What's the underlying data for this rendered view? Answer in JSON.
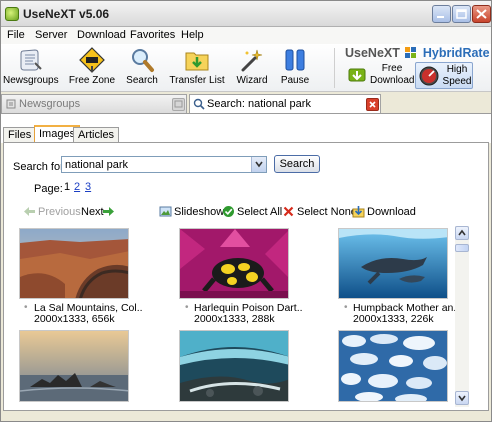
{
  "window": {
    "title": "UseNeXT v5.06"
  },
  "menu": [
    "File",
    "Server",
    "Download",
    "Favorites",
    "Help"
  ],
  "toolbar": {
    "buttons": [
      {
        "label": "Newsgroups",
        "icon": "newsgroups-scroll-icon"
      },
      {
        "label": "Free Zone",
        "icon": "free-zone-sign-icon"
      },
      {
        "label": "Search",
        "icon": "magnifier-icon"
      },
      {
        "label": "Transfer List",
        "icon": "transfer-list-folder-icon"
      },
      {
        "label": "Wizard",
        "icon": "wizard-wand-icon"
      },
      {
        "label": "Pause",
        "icon": "pause-icon"
      }
    ],
    "brand": {
      "name": "UseNeXT",
      "product": "HybridRate"
    },
    "speed_modes": [
      {
        "label_line1": "Free",
        "label_line2": "Download",
        "active": false
      },
      {
        "label_line1": "High",
        "label_line2": "Speed",
        "active": true
      }
    ]
  },
  "doc_tabs": [
    {
      "label": "Newsgroups",
      "active": false
    },
    {
      "label": "Search: national park",
      "active": true
    }
  ],
  "sub_tabs": [
    {
      "label": "Files",
      "active": false
    },
    {
      "label": "Images",
      "active": true
    },
    {
      "label": "Articles",
      "active": false
    }
  ],
  "search": {
    "label": "Search for:",
    "value": "national park",
    "button": "Search"
  },
  "pagination": {
    "label": "Page:",
    "current": "1",
    "pages": [
      "2",
      "3"
    ]
  },
  "actions": {
    "previous": "Previous",
    "next": "Next",
    "slideshow": "Slideshow",
    "select_all": "Select All",
    "select_none": "Select None",
    "download": "Download"
  },
  "results": [
    {
      "title": "La Sal Mountains, Col..",
      "info": "2000x1333, 656k"
    },
    {
      "title": "Harlequin Poison Dart..",
      "info": "2000x1333, 288k"
    },
    {
      "title": "Humpback Mother an..",
      "info": "2000x1333, 226k"
    },
    {
      "title": "",
      "info": ""
    },
    {
      "title": "",
      "info": ""
    },
    {
      "title": "",
      "info": ""
    }
  ],
  "colors": {
    "accent_blue": "#2b6db8",
    "link": "#1b3fc4",
    "active_tab_border": "#f2b043",
    "close_red": "#c8442c"
  }
}
